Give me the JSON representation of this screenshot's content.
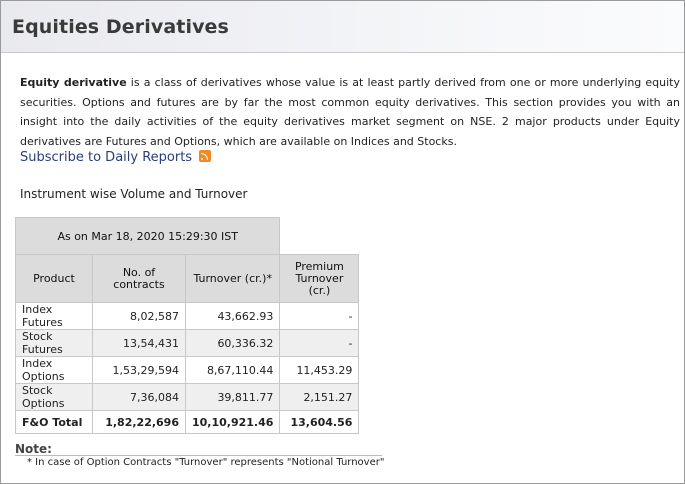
{
  "page": {
    "title": "Equities Derivatives"
  },
  "intro": {
    "term": "Equity derivative",
    "text": " is a class of derivatives whose value is at least partly derived from one or more underlying equity securities. Options and futures are by far the most common equity derivatives. This section provides you with an insight into the daily activities of the equity derivatives market segment on NSE. 2 major products under Equity derivatives are Futures and Options, which are available on Indices and Stocks."
  },
  "subscribe": {
    "label": "Subscribe to Daily Reports",
    "icon": "rss-icon"
  },
  "section": {
    "title": "Instrument wise Volume and Turnover"
  },
  "table": {
    "as_on": "As on Mar 18, 2020 15:29:30 IST",
    "headers": {
      "product": "Product",
      "contracts": "No. of contracts",
      "turnover": "Turnover (cr.)*",
      "premium": "Premium Turnover (cr.)"
    },
    "rows": [
      {
        "product": "Index Futures",
        "contracts": "8,02,587",
        "turnover": "43,662.93",
        "premium": "-"
      },
      {
        "product": "Stock Futures",
        "contracts": "13,54,431",
        "turnover": "60,336.32",
        "premium": "-"
      },
      {
        "product": "Index Options",
        "contracts": "1,53,29,594",
        "turnover": "8,67,110.44",
        "premium": "11,453.29"
      },
      {
        "product": "Stock Options",
        "contracts": "7,36,084",
        "turnover": "39,811.77",
        "premium": "2,151.27"
      },
      {
        "product": "F&O Total",
        "contracts": "1,82,22,696",
        "turnover": "10,10,921.46",
        "premium": "13,604.56"
      }
    ]
  },
  "note": {
    "label": "Note:",
    "text": "* In case of Option Contracts \"Turnover\" represents \"Notional Turnover\""
  },
  "colors": {
    "link": "#2a3f7a",
    "header_cell": "#dcdcdc",
    "alt_row": "#efefef",
    "rss": "#f08a24"
  }
}
